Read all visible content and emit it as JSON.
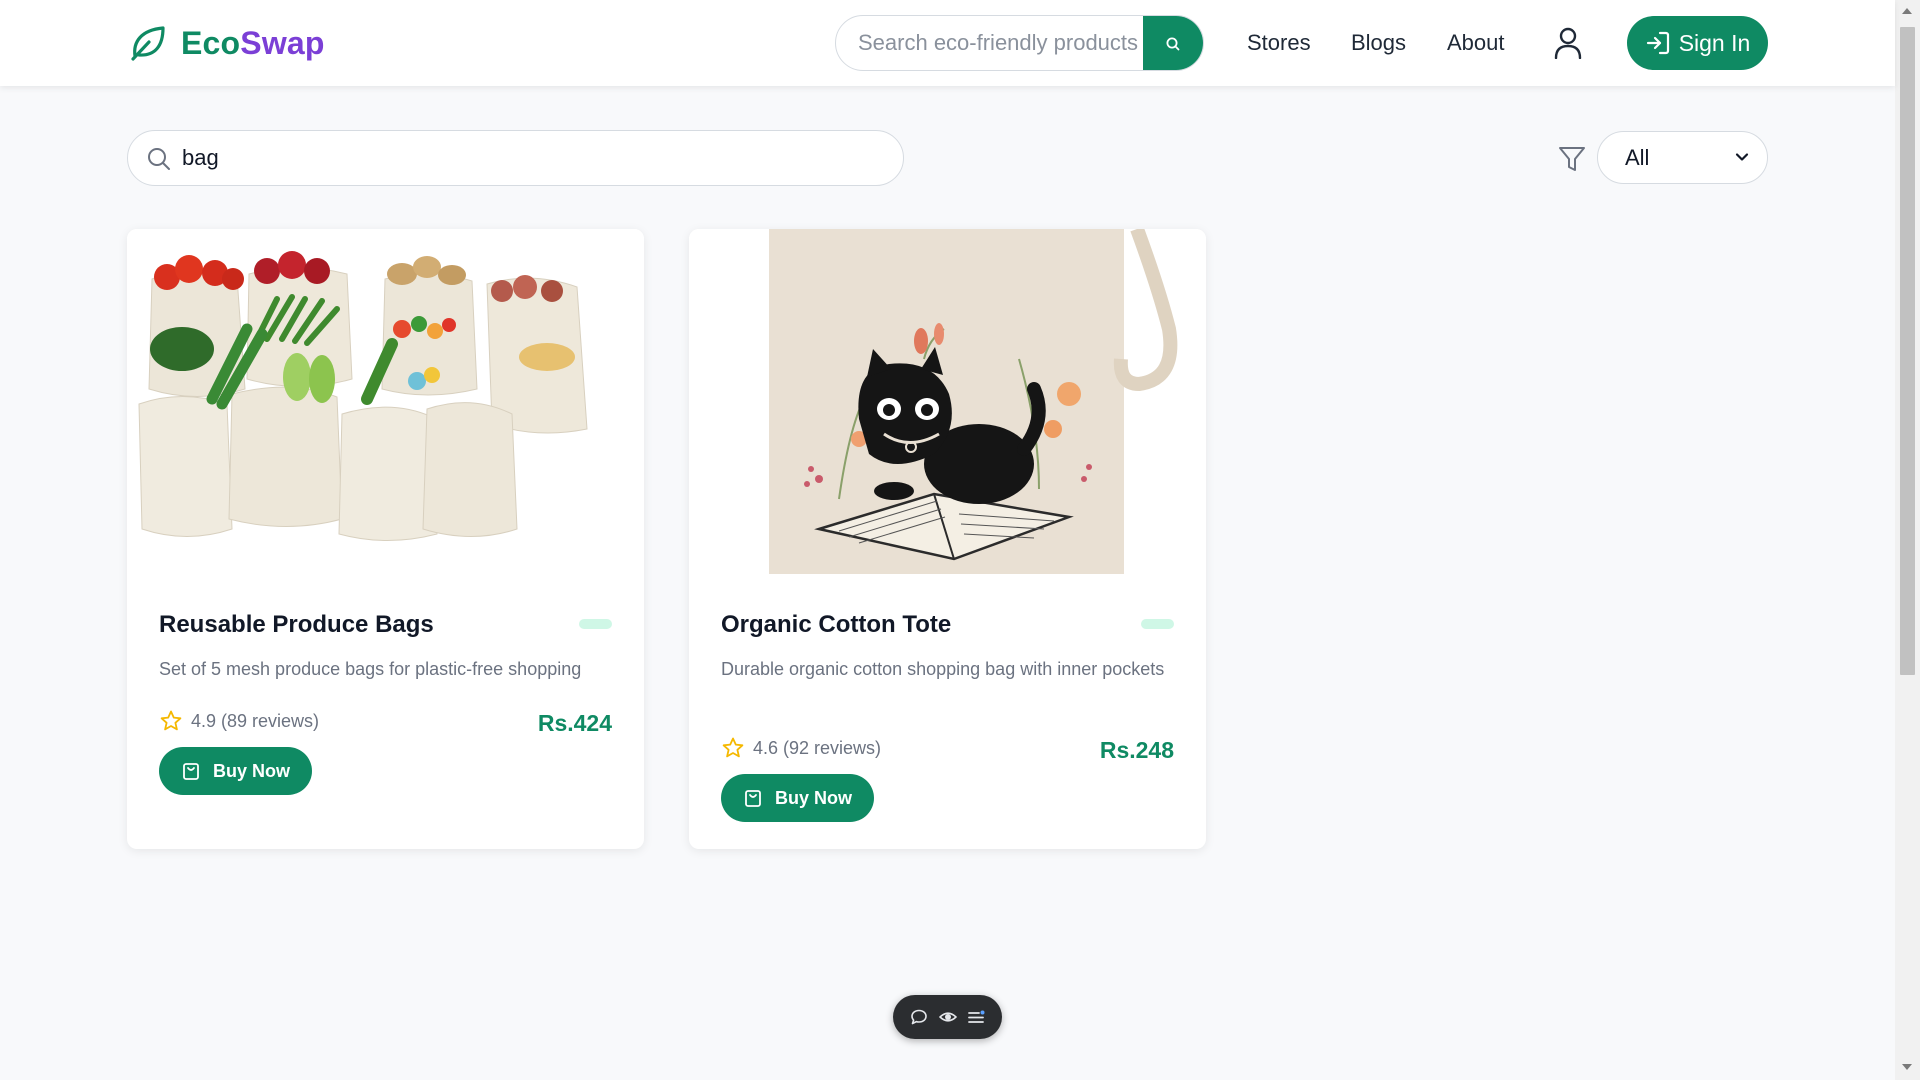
{
  "header": {
    "brand_part1": "Eco",
    "brand_part2": "Swap",
    "search_placeholder": "Search eco-friendly products",
    "nav": [
      "Stores",
      "Blogs",
      "About"
    ],
    "signin_label": "Sign In"
  },
  "filters": {
    "search_value": "bag",
    "category_selected": "All"
  },
  "products": [
    {
      "title": "Reusable Produce Bags",
      "description": "Set of 5 mesh produce bags for plastic-free shopping",
      "rating": "4.9 (89 reviews)",
      "price": "Rs.424",
      "buy_label": "Buy Now",
      "image": "produce-bags-photo"
    },
    {
      "title": "Organic Cotton Tote",
      "description": "Durable organic cotton shopping bag with inner pockets",
      "rating": "4.6 (92 reviews)",
      "price": "Rs.248",
      "buy_label": "Buy Now",
      "image": "cat-tote-bag-photo"
    }
  ],
  "colors": {
    "primary": "#0f8a63",
    "brand_purple": "#7b3fd6",
    "star": "#f5b800",
    "background": "#f8f9fb"
  }
}
